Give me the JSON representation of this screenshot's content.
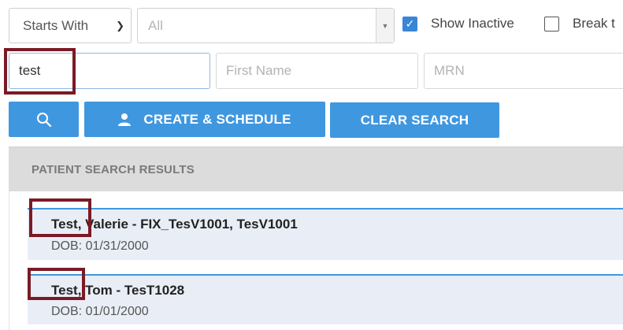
{
  "filters": {
    "match_mode": "Starts With",
    "location": "All",
    "show_inactive_label": "Show Inactive",
    "show_inactive_checked": true,
    "break_label": "Break t",
    "break_checked": false
  },
  "search": {
    "last_name_value": "test",
    "first_name_placeholder": "First Name",
    "mrn_placeholder": "MRN"
  },
  "buttons": {
    "search_icon": "search-icon",
    "create_schedule": "CREATE & SCHEDULE",
    "create_icon": "user-icon",
    "clear_search": "CLEAR SEARCH"
  },
  "results": {
    "header": "PATIENT SEARCH RESULTS",
    "items": [
      {
        "name": "Test, Valerie - FIX_TesV1001, TesV1001",
        "dob": "DOB: 01/31/2000"
      },
      {
        "name": "Test, Tom - TesT1028",
        "dob": "DOB: 01/01/2000"
      }
    ]
  },
  "colors": {
    "accent": "#3f97e0",
    "highlight": "#7b1a25",
    "result_bg": "#e9eef6",
    "header_bg": "#dcdcdc"
  }
}
